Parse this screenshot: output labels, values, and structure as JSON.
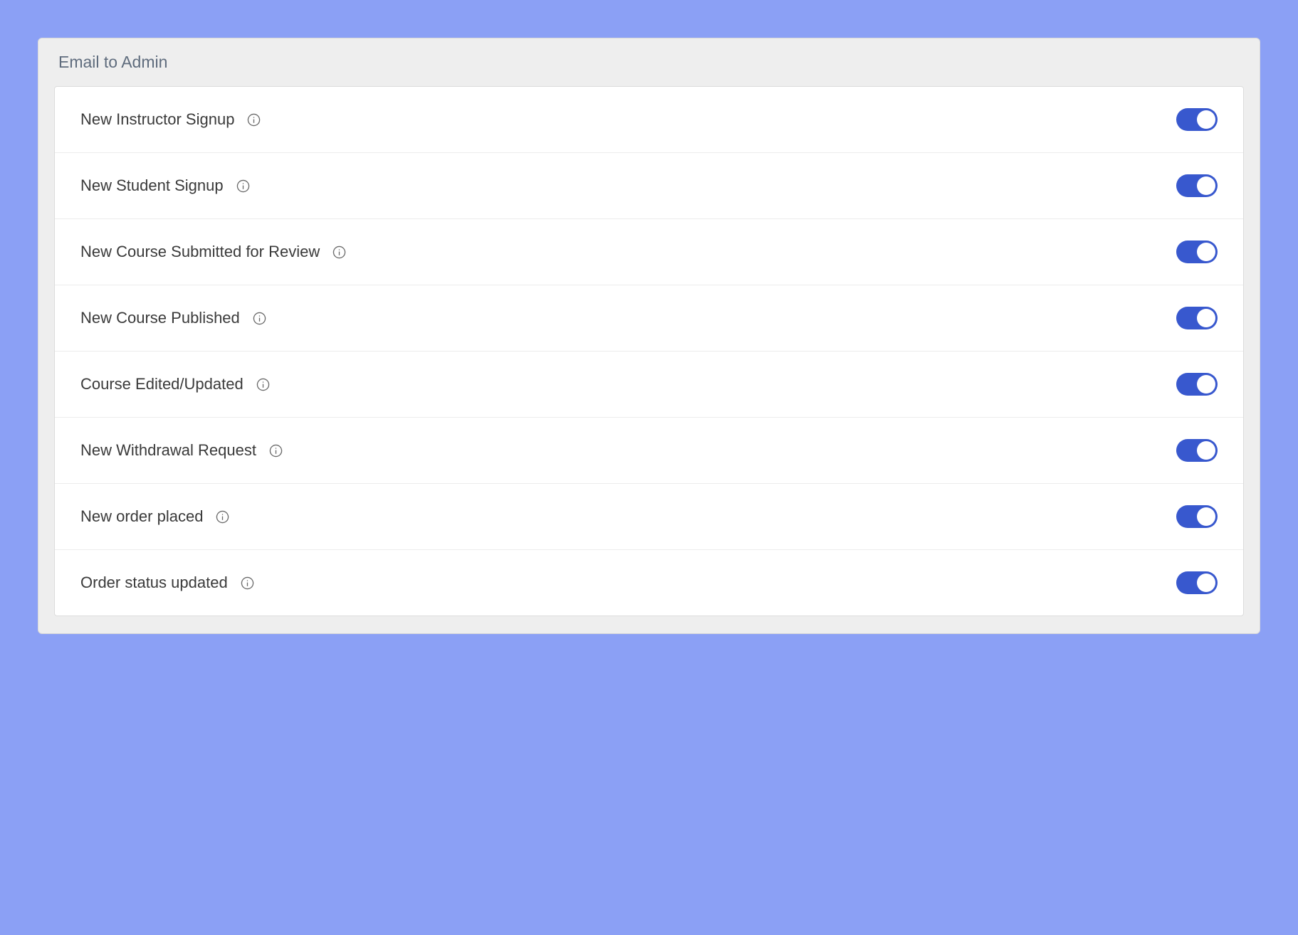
{
  "panel": {
    "title": "Email to Admin",
    "items": [
      {
        "label": "New Instructor Signup",
        "enabled": true
      },
      {
        "label": "New Student Signup",
        "enabled": true
      },
      {
        "label": "New Course Submitted for Review",
        "enabled": true
      },
      {
        "label": "New Course Published",
        "enabled": true
      },
      {
        "label": "Course Edited/Updated",
        "enabled": true
      },
      {
        "label": "New Withdrawal Request",
        "enabled": true
      },
      {
        "label": "New order placed",
        "enabled": true
      },
      {
        "label": "Order status updated",
        "enabled": true
      }
    ]
  },
  "colors": {
    "page_bg": "#8ba0f5",
    "panel_bg": "#eeeeee",
    "toggle_on": "#3858ce"
  }
}
